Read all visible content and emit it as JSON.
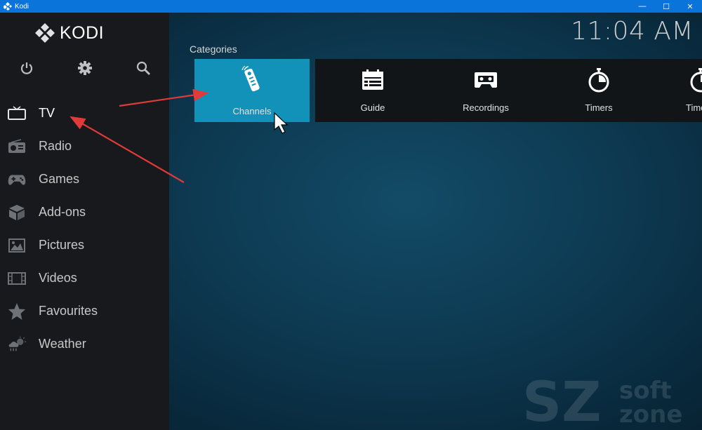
{
  "window": {
    "title": "Kodi",
    "minimize": "—",
    "maximize": "☐",
    "close": "✕"
  },
  "logo": {
    "text": "KODI"
  },
  "clock": "11:04 AM",
  "section_title": "Categories",
  "menu": [
    {
      "label": "TV",
      "icon": "tv-icon"
    },
    {
      "label": "Radio",
      "icon": "radio-icon"
    },
    {
      "label": "Games",
      "icon": "gamepad-icon"
    },
    {
      "label": "Add-ons",
      "icon": "addons-box-icon"
    },
    {
      "label": "Pictures",
      "icon": "picture-icon"
    },
    {
      "label": "Videos",
      "icon": "film-icon"
    },
    {
      "label": "Favourites",
      "icon": "star-icon"
    },
    {
      "label": "Weather",
      "icon": "weather-icon"
    }
  ],
  "tiles": [
    {
      "label": "Channels",
      "icon": "remote-icon"
    },
    {
      "label": "Guide",
      "icon": "calendar-icon"
    },
    {
      "label": "Recordings",
      "icon": "cassette-icon"
    },
    {
      "label": "Timers",
      "icon": "stopwatch-icon"
    },
    {
      "label": "Time",
      "icon": "stopwatch-icon"
    }
  ],
  "watermark": {
    "line1": "soft",
    "line2": "zone",
    "mark": "SZ"
  },
  "colors": {
    "accent": "#1292b8",
    "sidebar": "#17191c",
    "arrow": "#e03a3a",
    "titlebar": "#0a74da"
  }
}
